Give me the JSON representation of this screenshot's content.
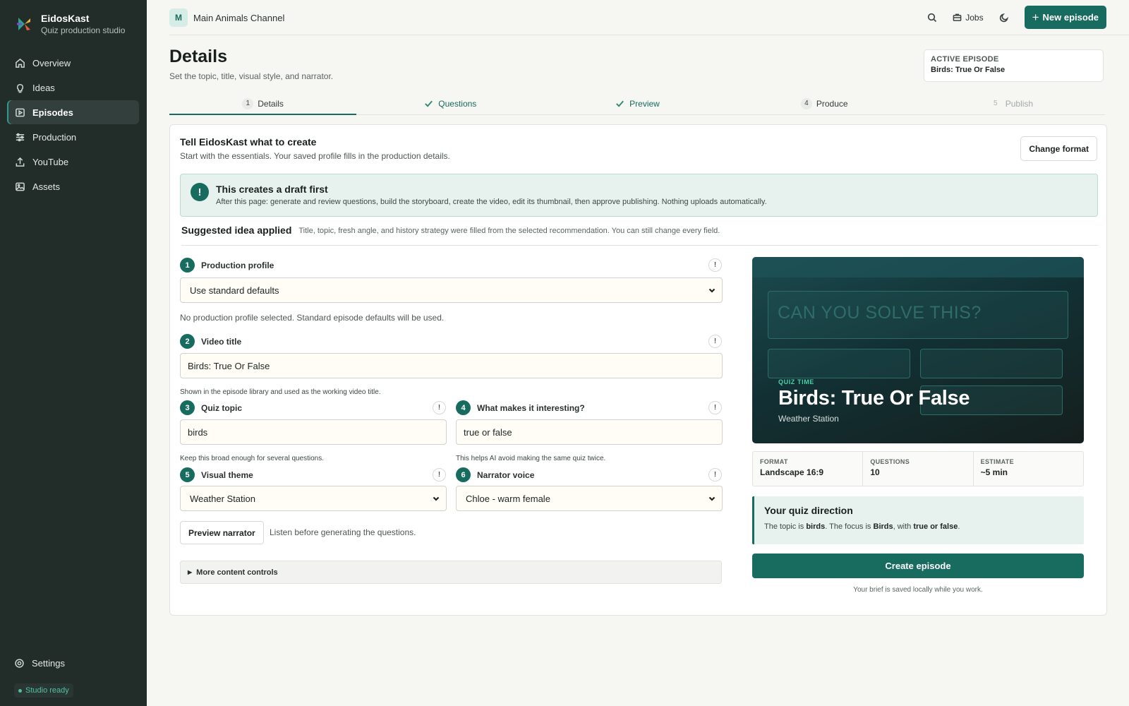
{
  "brand": {
    "name": "EidosKast",
    "subtitle": "Quiz production studio"
  },
  "sidebar": {
    "items": [
      {
        "label": "Overview",
        "icon": "home-icon"
      },
      {
        "label": "Ideas",
        "icon": "lightbulb-icon"
      },
      {
        "label": "Episodes",
        "icon": "play-square-icon",
        "active": true
      },
      {
        "label": "Production",
        "icon": "sliders-icon"
      },
      {
        "label": "YouTube",
        "icon": "upload-icon"
      },
      {
        "label": "Assets",
        "icon": "image-icon"
      }
    ],
    "settings_label": "Settings",
    "status_label": "Studio ready"
  },
  "topbar": {
    "channel_initial": "M",
    "channel_name": "Main Animals Channel",
    "jobs_label": "Jobs",
    "new_episode_label": "New episode"
  },
  "page": {
    "title": "Details",
    "subtitle": "Set the topic, title, visual style, and narrator.",
    "active_episode_label": "ACTIVE EPISODE",
    "active_episode_value": "Birds: True Or False"
  },
  "steps": [
    {
      "num": "1",
      "label": "Details",
      "state": "active"
    },
    {
      "num": "",
      "label": "Questions",
      "state": "done"
    },
    {
      "num": "",
      "label": "Preview",
      "state": "done"
    },
    {
      "num": "4",
      "label": "Produce",
      "state": "pending"
    },
    {
      "num": "5",
      "label": "Publish",
      "state": "disabled"
    }
  ],
  "card": {
    "title": "Tell EidosKast what to create",
    "subtitle": "Start with the essentials. Your saved profile fills in the production details.",
    "change_format_label": "Change format"
  },
  "notice": {
    "icon": "!",
    "title": "This creates a draft first",
    "body": "After this page: generate and review questions, build the storyboard, create the video, edit its thumbnail, then approve publishing. Nothing uploads automatically."
  },
  "suggestion": {
    "title": "Suggested idea applied",
    "body": "Title, topic, fresh angle, and history strategy were filled from the selected recommendation. You can still change every field."
  },
  "form": {
    "profile": {
      "num": "1",
      "label": "Production profile",
      "value": "Use standard defaults",
      "note": "No production profile selected. Standard episode defaults will be used."
    },
    "title": {
      "num": "2",
      "label": "Video title",
      "value": "Birds: True Or False",
      "hint": "Shown in the episode library and used as the working video title."
    },
    "topic": {
      "num": "3",
      "label": "Quiz topic",
      "value": "birds",
      "hint": "Keep this broad enough for several questions."
    },
    "angle": {
      "num": "4",
      "label": "What makes it interesting?",
      "value": "true or false",
      "hint": "This helps AI avoid making the same quiz twice."
    },
    "theme": {
      "num": "5",
      "label": "Visual theme",
      "value": "Weather Station"
    },
    "voice": {
      "num": "6",
      "label": "Narrator voice",
      "value": "Chloe - warm female"
    },
    "info_icon": "!",
    "preview_narrator_label": "Preview narrator",
    "preview_narrator_note": "Listen before generating the questions.",
    "more_controls_label": "More content controls"
  },
  "preview": {
    "ghost_text": "CAN YOU SOLVE THIS?",
    "tag": "QUIZ TIME",
    "title": "Birds: True Or False",
    "subtitle": "Weather Station"
  },
  "stats": [
    {
      "label": "FORMAT",
      "value": "Landscape 16:9"
    },
    {
      "label": "QUESTIONS",
      "value": "10"
    },
    {
      "label": "ESTIMATE",
      "value": "~5 min"
    }
  ],
  "direction": {
    "title": "Your quiz direction",
    "p1": "The topic is ",
    "topic": "birds",
    "p2": ". The focus is ",
    "focus": "Birds",
    "p3": ", with ",
    "angle": "true or false",
    "p4": "."
  },
  "create_label": "Create episode",
  "saved_note": "Your brief is saved locally while you work.",
  "colors": {
    "accent": "#176b5f",
    "sidebar": "#222d2a",
    "notice_bg": "#e7f2ee",
    "status": "#4fc29c"
  }
}
